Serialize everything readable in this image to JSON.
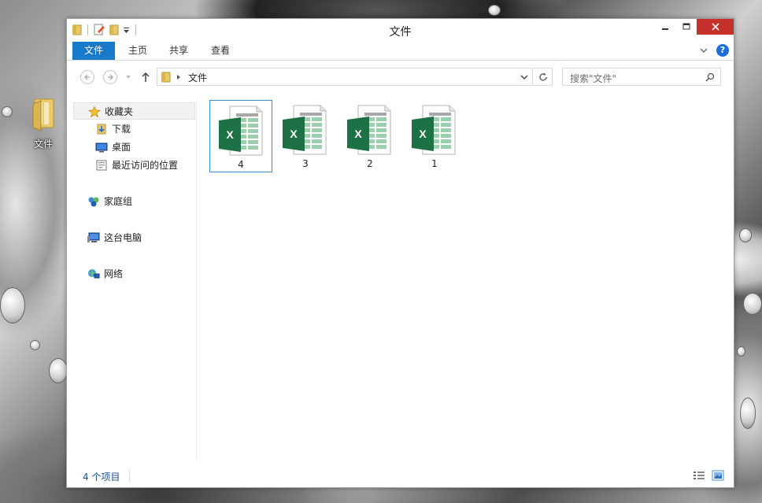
{
  "window": {
    "title": "文件"
  },
  "desktop": {
    "icon_label": "文件"
  },
  "ribbon": {
    "tabs": [
      "文件",
      "主页",
      "共享",
      "查看"
    ]
  },
  "address": {
    "path": "文件",
    "search_placeholder": "搜索\"文件\""
  },
  "sidebar": {
    "items": [
      {
        "label": "收藏夹",
        "icon": "star-icon"
      },
      {
        "label": "下载",
        "icon": "download-folder-icon"
      },
      {
        "label": "桌面",
        "icon": "desktop-icon"
      },
      {
        "label": "最近访问的位置",
        "icon": "recent-places-icon"
      },
      {
        "label": "家庭组",
        "icon": "homegroup-icon"
      },
      {
        "label": "这台电脑",
        "icon": "this-pc-icon"
      },
      {
        "label": "网络",
        "icon": "network-icon"
      }
    ]
  },
  "files": [
    {
      "name": "4",
      "icon": "excel-file-icon"
    },
    {
      "name": "3",
      "icon": "excel-file-icon"
    },
    {
      "name": "2",
      "icon": "excel-file-icon"
    },
    {
      "name": "1",
      "icon": "excel-file-icon"
    }
  ],
  "status": {
    "item_count": "4 个项目"
  },
  "colors": {
    "accent": "#1979ca",
    "close": "#c7312c",
    "excel_green": "#1e7145",
    "selection_border": "#3b8cd8"
  }
}
